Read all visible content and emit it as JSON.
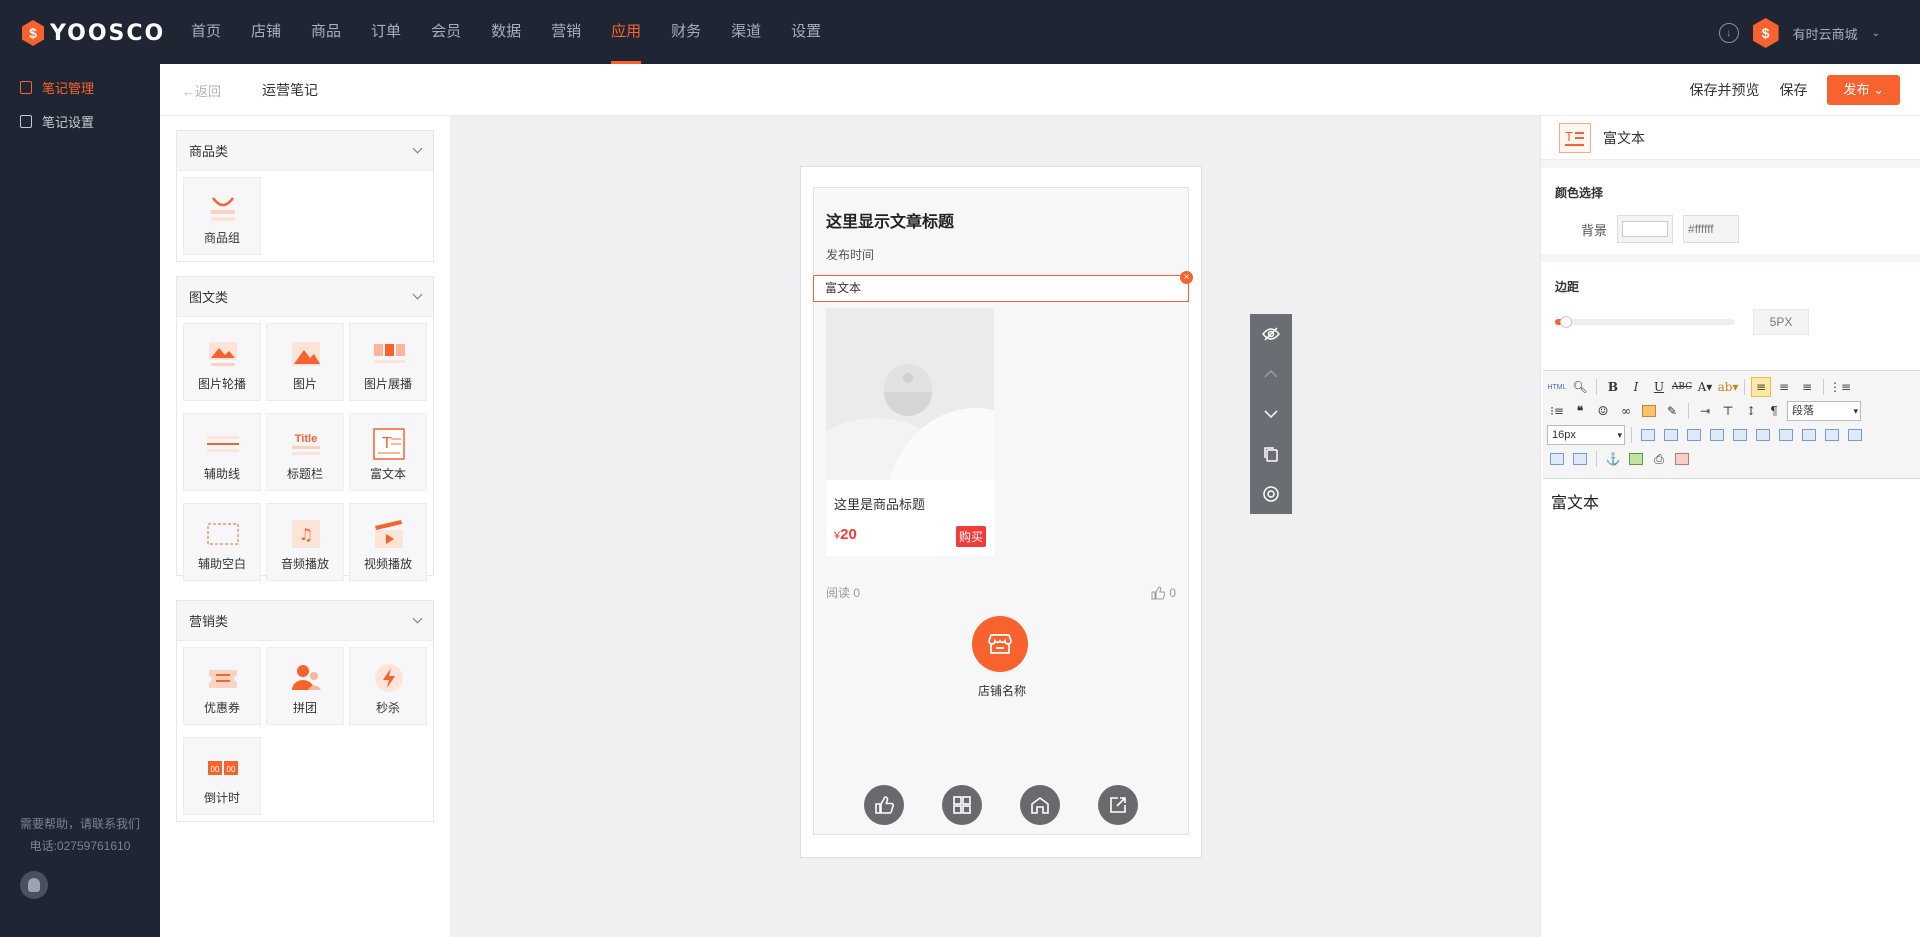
{
  "brand": {
    "logo_text": "YOOSCO",
    "accent": "#f8622e"
  },
  "nav": {
    "items": [
      "首页",
      "店铺",
      "商品",
      "订单",
      "会员",
      "数据",
      "营销",
      "应用",
      "财务",
      "渠道",
      "设置"
    ],
    "active": "应用"
  },
  "user": {
    "store_name": "有时云商城"
  },
  "sidebar": {
    "items": [
      {
        "label": "笔记管理",
        "active": true
      },
      {
        "label": "笔记设置",
        "active": false
      }
    ],
    "help_text": "需要帮助，请联系我们",
    "phone": "电话:02759761610"
  },
  "header": {
    "back": "←返回",
    "title": "运营笔记",
    "save_preview": "保存并预览",
    "save": "保存",
    "publish": "发布"
  },
  "components": {
    "groups": [
      {
        "title": "商品类",
        "items": [
          "商品组"
        ]
      },
      {
        "title": "图文类",
        "items": [
          "图片轮播",
          "图片",
          "图片展播",
          "辅助线",
          "标题栏",
          "富文本",
          "辅助空白",
          "音频播放",
          "视频播放"
        ]
      },
      {
        "title": "营销类",
        "items": [
          "优惠券",
          "拼团",
          "秒杀",
          "倒计时"
        ]
      }
    ]
  },
  "preview": {
    "article_title": "这里显示文章标题",
    "publish_time": "发布时间",
    "rich_text": "富文本",
    "goods_title": "这里是商品标题",
    "price_symbol": "¥",
    "price": "20",
    "buy": "购买",
    "reads": "阅读 0",
    "likes": "0",
    "shop_name": "店铺名称"
  },
  "props": {
    "title": "富文本",
    "color_section": "颜色选择",
    "bg_label": "背景",
    "bg_hex": "#ffffff",
    "margin_section": "边距",
    "margin_value": "5PX",
    "margin_fraction": 0.03,
    "font_size": "16px",
    "paragraph": "段落",
    "editor_content": "富文本"
  }
}
